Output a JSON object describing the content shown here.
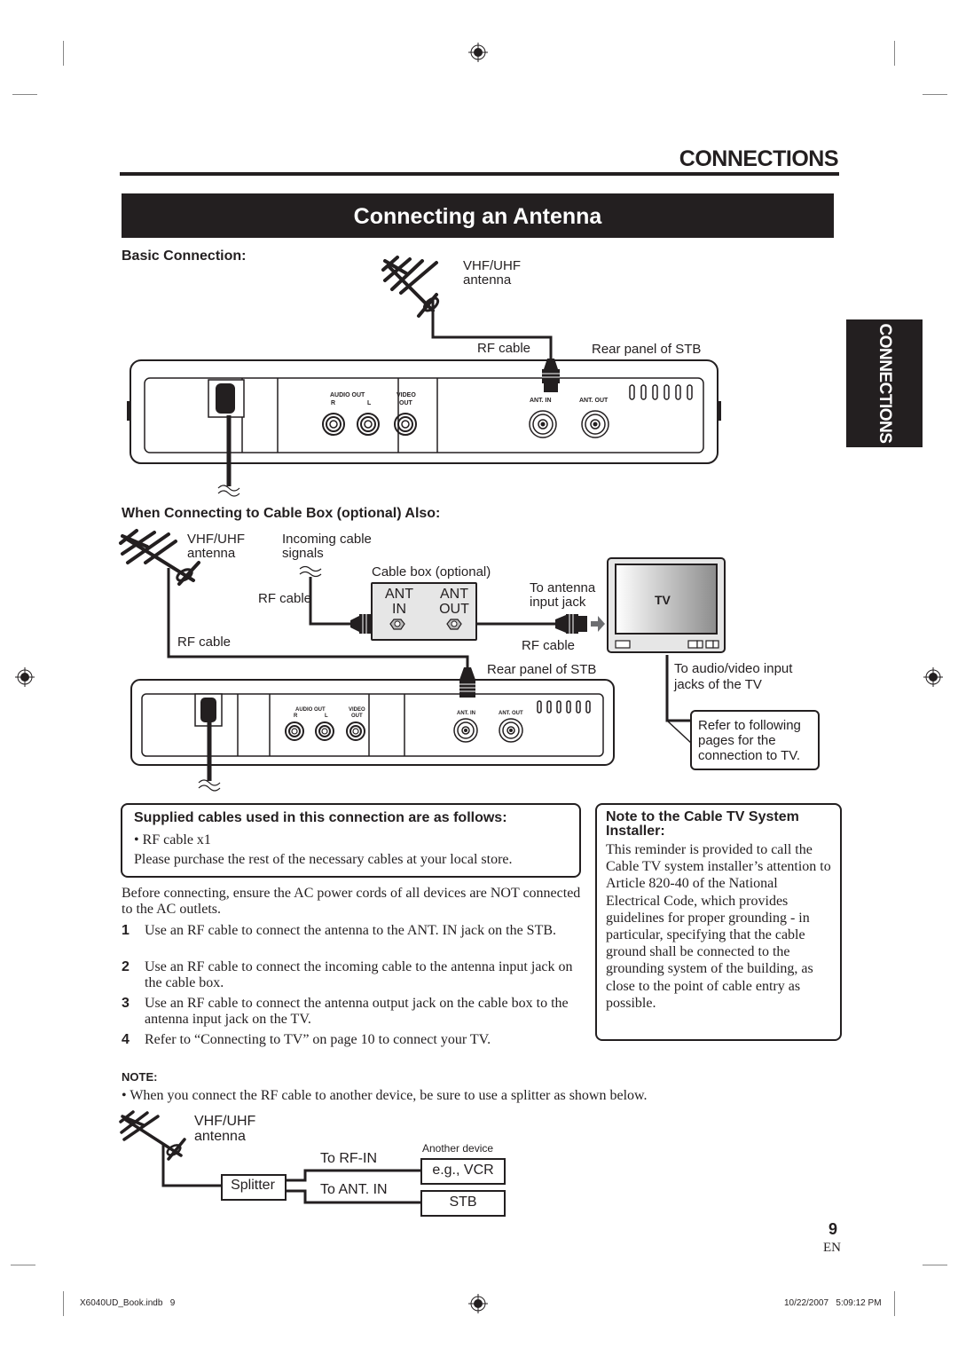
{
  "header": {
    "section_title": "CONNECTIONS",
    "banner_title": "Connecting an Antenna",
    "side_tab": "CONNECTIONS"
  },
  "basic": {
    "heading": "Basic Connection:",
    "antenna_label_line1": "VHF/UHF",
    "antenna_label_line2": "antenna",
    "rf_cable": "RF cable",
    "rear_panel": "Rear panel of STB",
    "audio_out": "AUDIO OUT",
    "audio_r": "R",
    "audio_l": "L",
    "video_out_line1": "VIDEO",
    "video_out_line2": "OUT",
    "ant_in": "ANT. IN",
    "ant_out": "ANT. OUT"
  },
  "cable_box": {
    "heading": "When Connecting to Cable Box (optional) Also:",
    "antenna_label_line1": "VHF/UHF",
    "antenna_label_line2": "antenna",
    "incoming_line1": "Incoming cable",
    "incoming_line2": "signals",
    "cable_box_label": "Cable box (optional)",
    "rf_cable_upper": "RF cable",
    "rf_cable_left": "RF cable",
    "rf_cable_right": "RF cable",
    "box_ant_in_line1": "ANT",
    "box_ant_in_line2": "IN",
    "box_ant_out_line1": "ANT",
    "box_ant_out_line2": "OUT",
    "to_antenna_line1": "To antenna",
    "to_antenna_line2": "input jack",
    "tv_label": "TV",
    "rear_panel": "Rear panel of STB",
    "to_av_line1": "To audio/video input",
    "to_av_line2": "jacks of the TV",
    "refer_line1": "Refer to following",
    "refer_line2": "pages for the",
    "refer_line3": "connection to TV.",
    "audio_out": "AUDIO OUT",
    "audio_r": "R",
    "audio_l": "L",
    "video_out_line1": "VIDEO",
    "video_out_line2": "OUT",
    "ant_in": "ANT. IN",
    "ant_out": "ANT. OUT"
  },
  "supplied": {
    "heading": "Supplied cables used in this connection are as follows:",
    "item": "• RF cable x1",
    "note": "Please purchase the rest of the necessary cables at your local store."
  },
  "warning": "Before connecting, ensure the AC power cords of all devices are NOT connected to the AC outlets.",
  "steps": [
    {
      "num": "1",
      "text": "Use an RF cable to connect the antenna to the ANT. IN jack on the STB."
    },
    {
      "num": "2",
      "text": "Use an RF cable to connect the incoming cable to the antenna input jack on the cable box."
    },
    {
      "num": "3",
      "text": "Use an RF cable to connect the antenna output jack on the cable box to the antenna input jack on the TV."
    },
    {
      "num": "4",
      "text": "Refer to “Connecting to TV” on page 10 to connect your TV."
    }
  ],
  "installer_note": {
    "heading": "Note to the Cable TV System Installer:",
    "body": "This reminder is provided to call the Cable TV system installer’s attention to Article 820-40 of the National Electrical Code, which provides guidelines for proper grounding - in particular, specifying that the cable ground shall be connected to the grounding system of the building, as close to the point of cable entry as possible."
  },
  "note": {
    "heading": "NOTE:",
    "bullet": "•  When you connect the RF cable to another device, be sure to use a splitter as shown below."
  },
  "splitter": {
    "antenna_line1": "VHF/UHF",
    "antenna_line2": "antenna",
    "splitter": "Splitter",
    "to_rf_in": "To RF-IN",
    "to_ant_in": "To ANT. IN",
    "another_device": "Another device",
    "vcr": "e.g., VCR",
    "stb": "STB"
  },
  "footer": {
    "page_number": "9",
    "language": "EN",
    "file": "X6040UD_Book.indb   9",
    "timestamp": "10/22/2007   5:09:12 PM"
  },
  "icons": {
    "registration_mark": "crosshair-target",
    "antenna": "yagi-antenna",
    "tv": "television"
  },
  "colors": {
    "ink": "#231f20",
    "panel_gray": "#e6e6e6",
    "crop_mark": "#888888"
  }
}
